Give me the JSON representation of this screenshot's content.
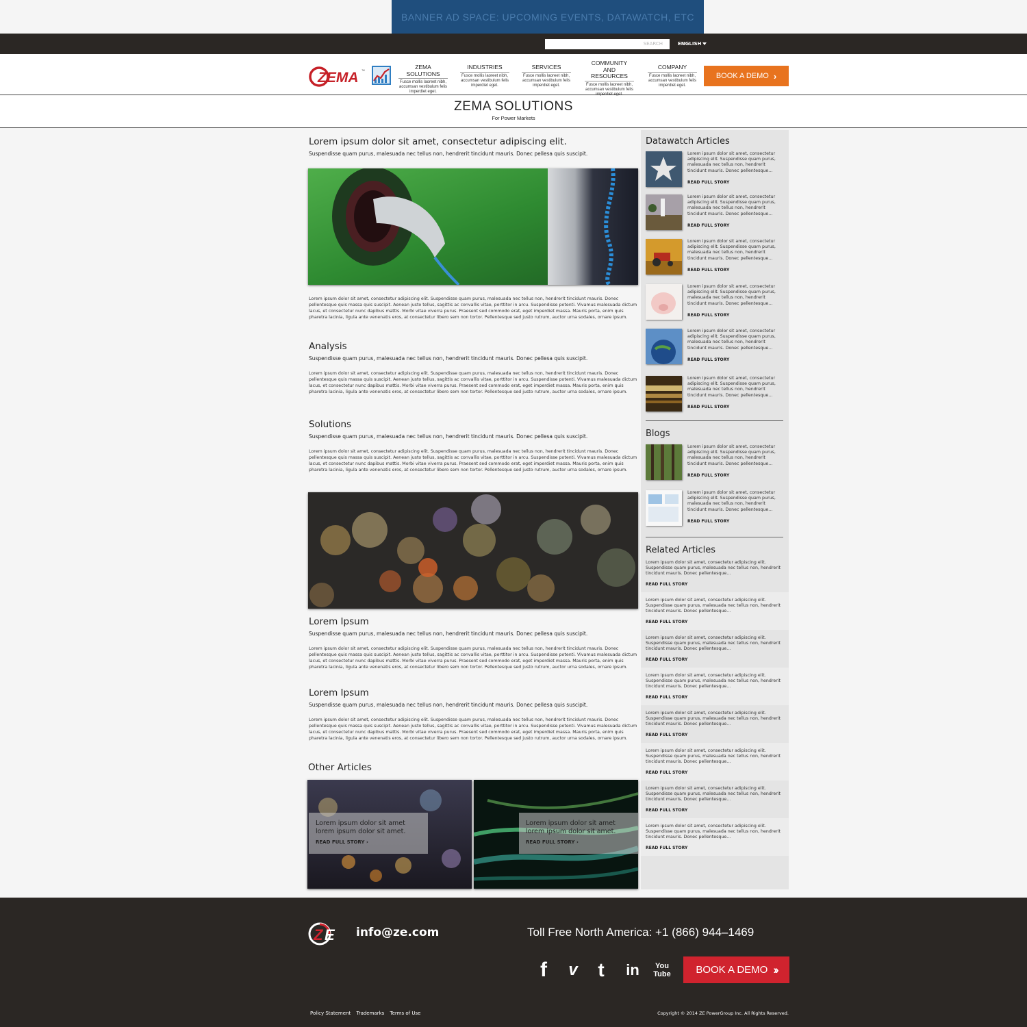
{
  "banner": {
    "text": "BANNER AD SPACE: UPCOMING EVENTS, DATAWATCH, ETC"
  },
  "topbar": {
    "search_placeholder": "SEARCH",
    "language": "ENGLISH"
  },
  "logo": {
    "text": "ZEMA",
    "tm": "™"
  },
  "nav": [
    {
      "title": "ZEMA SOLUTIONS",
      "desc": "Fusce mollis laoreet nibh, accumsan vestibulum felis imperdiet eget."
    },
    {
      "title": "INDUSTRIES",
      "desc": "Fusce mollis laoreet nibh, accumsan vestibulum felis imperdiet eget."
    },
    {
      "title": "SERVICES",
      "desc": "Fusce mollis laoreet nibh, accumsan vestibulum felis imperdiet eget."
    },
    {
      "title": "COMMUNITY AND RESOURCES",
      "desc": "Fusce mollis laoreet nibh, accumsan vestibulum felis imperdiet eget."
    },
    {
      "title": "COMPANY",
      "desc": "Fusce mollis laoreet nibh, accumsan vestibulum felis imperdiet eget."
    }
  ],
  "book_demo_top": "BOOK A DEMO",
  "page": {
    "title": "ZEMA SOLUTIONS",
    "subtitle": "For Power Markets"
  },
  "main": {
    "heading": "Lorem ipsum dolor sit amet, consectetur adipiscing elit.",
    "lead": "Suspendisse quam purus, malesuada nec tellus non, hendrerit tincidunt mauris. Donec pellesa quis suscipit.",
    "body": "Lorem ipsum dolor sit amet, consectetur adipiscing elit. Suspendisse quam purus, malesuada nec tellus non, hendrerit tincidunt mauris. Donec pellentesque quis massa quis suscipit. Aenean justo tellus, sagittis ac convallis vitae, porttitor in arcu. Suspendisse potenti. Vivamus malesuada dictum lacus, et consectetur nunc dapibus mattis. Morbi vitae viverra purus. Praesent sed commodo erat, eget imperdiet massa. Mauris porta, enim quis pharetra lacinia, ligula ante venenatis eros, at consectetur libero sem non tortor. Pellentesque sed justo rutrum, auctor urna sodales, ornare ipsum.",
    "sections": [
      {
        "heading": "Analysis",
        "lead": "Suspendisse quam purus, malesuada nec tellus non, hendrerit tincidunt mauris. Donec pellesa quis suscipit.",
        "body": "Lorem ipsum dolor sit amet, consectetur adipiscing elit. Suspendisse quam purus, malesuada nec tellus non, hendrerit tincidunt mauris. Donec pellentesque quis massa quis suscipit. Aenean justo tellus, sagittis ac convallis vitae, porttitor in arcu. Suspendisse potenti. Vivamus malesuada dictum lacus, et consectetur nunc dapibus mattis. Morbi vitae viverra purus. Praesent sed commodo erat, eget imperdiet massa. Mauris porta, enim quis pharetra lacinia, ligula ante venenatis eros, at consectetur libero sem non tortor. Pellentesque sed justo rutrum, auctor urna sodales, ornare ipsum."
      },
      {
        "heading": "Solutions",
        "lead": "Suspendisse quam purus, malesuada nec tellus non, hendrerit tincidunt mauris. Donec pellesa quis suscipit.",
        "body": "Lorem ipsum dolor sit amet, consectetur adipiscing elit. Suspendisse quam purus, malesuada nec tellus non, hendrerit tincidunt mauris. Donec pellentesque quis massa quis suscipit. Aenean justo tellus, sagittis ac convallis vitae, porttitor in arcu. Suspendisse potenti. Vivamus malesuada dictum lacus, et consectetur nunc dapibus mattis. Morbi vitae viverra purus. Praesent sed commodo erat, eget imperdiet massa. Mauris porta, enim quis pharetra lacinia, ligula ante venenatis eros, at consectetur libero sem non tortor. Pellentesque sed justo rutrum, auctor urna sodales, ornare ipsum."
      },
      {
        "heading": "Lorem Ipsum",
        "lead": "Suspendisse quam purus, malesuada nec tellus non, hendrerit tincidunt mauris. Donec pellesa quis suscipit.",
        "body": "Lorem ipsum dolor sit amet, consectetur adipiscing elit. Suspendisse quam purus, malesuada nec tellus non, hendrerit tincidunt mauris. Donec pellentesque quis massa quis suscipit. Aenean justo tellus, sagittis ac convallis vitae, porttitor in arcu. Suspendisse potenti. Vivamus malesuada dictum lacus, et consectetur nunc dapibus mattis. Morbi vitae viverra purus. Praesent sed commodo erat, eget imperdiet massa. Mauris porta, enim quis pharetra lacinia, ligula ante venenatis eros, at consectetur libero sem non tortor. Pellentesque sed justo rutrum, auctor urna sodales, ornare ipsum."
      },
      {
        "heading": "Lorem Ipsum",
        "lead": "Suspendisse quam purus, malesuada nec tellus non, hendrerit tincidunt mauris. Donec pellesa quis suscipit.",
        "body": "Lorem ipsum dolor sit amet, consectetur adipiscing elit. Suspendisse quam purus, malesuada nec tellus non, hendrerit tincidunt mauris. Donec pellentesque quis massa quis suscipit. Aenean justo tellus, sagittis ac convallis vitae, porttitor in arcu. Suspendisse potenti. Vivamus malesuada dictum lacus, et consectetur nunc dapibus mattis. Morbi vitae viverra purus. Praesent sed commodo erat, eget imperdiet massa. Mauris porta, enim quis pharetra lacinia, ligula ante venenatis eros, at consectetur libero sem non tortor. Pellentesque sed justo rutrum, auctor urna sodales, ornare ipsum."
      }
    ],
    "other_heading": "Other Articles",
    "other_cards": [
      {
        "text": "Lorem ipsum dolor sit amet lorem ipsum dolor sit amet.",
        "link": "READ FULL STORY"
      },
      {
        "text": "Lorem ipsum dolor sit amet lorem ipsum dolor sit amet.",
        "link": "READ FULL STORY"
      }
    ]
  },
  "sidebar": {
    "datawatch_heading": "Datawatch Articles",
    "blogs_heading": "Blogs",
    "related_heading": "Related Articles",
    "item_text": "Lorem ipsum dolor sit amet, consectetur adipiscing elit. Suspendisse quam purus, malesuada nec tellus non, hendrerit tincidunt mauris. Donec pellentesque...",
    "read_label": "READ FULL STORY"
  },
  "footer": {
    "email": "info@ze.com",
    "phone": "Toll Free North America: +1 (866) 944–1469",
    "book_demo": "BOOK A DEMO",
    "social": {
      "facebook": "f",
      "vimeo": "v",
      "twitter": "t",
      "linkedin": "in",
      "youtube_top": "You",
      "youtube_bottom": "Tube"
    },
    "links": [
      "Policy Statement",
      "Trademarks",
      "Terms of Use"
    ],
    "copyright": "Copyright © 2014 ZE PowerGroup Inc. All Rights Reserved."
  },
  "colors": {
    "accent_orange": "#e8731e",
    "accent_red": "#d0232e",
    "dark": "#2b2724",
    "banner": "#1f4e7d"
  }
}
